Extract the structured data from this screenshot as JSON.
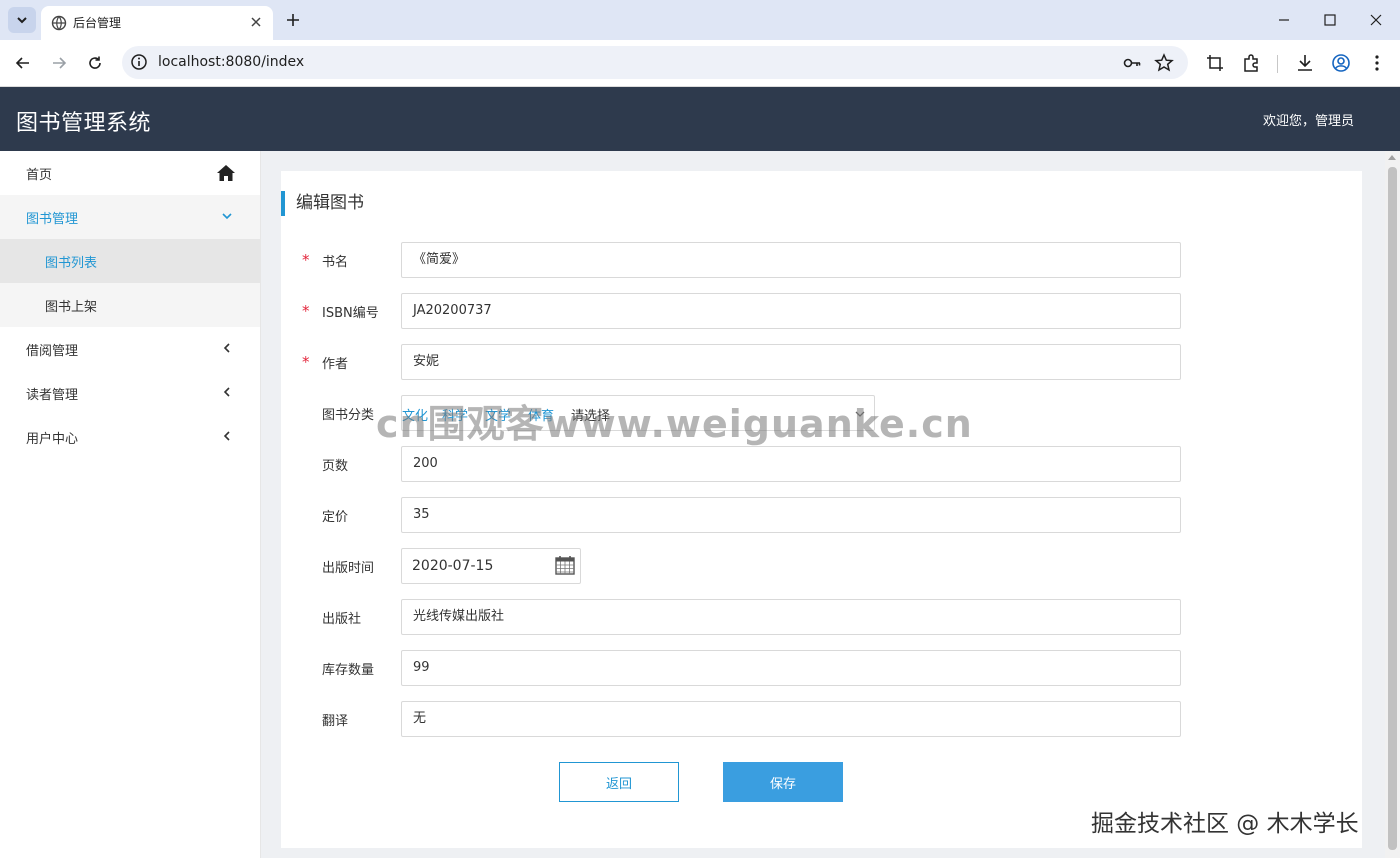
{
  "browser": {
    "tab_title": "后台管理",
    "url": "localhost:8080/index"
  },
  "app": {
    "title": "图书管理系统",
    "welcome": "欢迎您，管理员"
  },
  "sidebar": {
    "items": [
      {
        "label": "首页"
      },
      {
        "label": "图书管理"
      },
      {
        "label": "图书列表"
      },
      {
        "label": "图书上架"
      },
      {
        "label": "借阅管理"
      },
      {
        "label": "读者管理"
      },
      {
        "label": "用户中心"
      }
    ]
  },
  "form": {
    "title": "编辑图书",
    "required_mark": "*",
    "fields": {
      "name": {
        "label": "书名",
        "value": "《简爱》"
      },
      "isbn": {
        "label": "ISBN编号",
        "value": "JA20200737"
      },
      "author": {
        "label": "作者",
        "value": "安妮"
      },
      "category": {
        "label": "图书分类",
        "options": [
          "文化",
          "科学",
          "文学",
          "体育"
        ],
        "value": "请选择"
      },
      "pages": {
        "label": "页数",
        "value": "200"
      },
      "price": {
        "label": "定价",
        "value": "35"
      },
      "publish_date": {
        "label": "出版时间",
        "value": "2020-07-15"
      },
      "publisher": {
        "label": "出版社",
        "value": "光线传媒出版社"
      },
      "stock": {
        "label": "库存数量",
        "value": "99"
      },
      "translator": {
        "label": "翻译",
        "value": "无"
      }
    },
    "back_label": "返回",
    "save_label": "保存"
  },
  "watermarks": {
    "center": "cn围观客www.weiguanke.cn",
    "corner": "掘金技术社区 @ 木木学长"
  },
  "colors": {
    "header_bg": "#2e3a4d",
    "accent": "#2196d3",
    "save_bg": "#3a9ee0",
    "required": "#e3263c"
  }
}
